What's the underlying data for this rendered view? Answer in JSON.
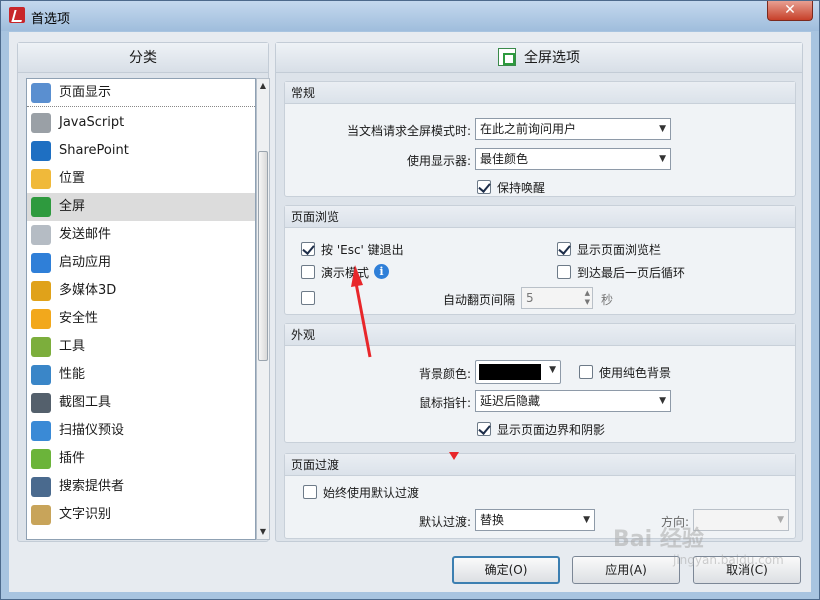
{
  "window": {
    "title": "首选项",
    "close_glyph": "✕"
  },
  "left": {
    "header": "分类",
    "items": [
      {
        "label": "页面显示",
        "icon": "page-display-icon",
        "color": "#5a8fd0"
      },
      {
        "label": "JavaScript",
        "icon": "javascript-icon",
        "color": "#9aa0a6"
      },
      {
        "label": "SharePoint",
        "icon": "sharepoint-icon",
        "color": "#1e6fc2"
      },
      {
        "label": "位置",
        "icon": "folder-icon",
        "color": "#f0b93a"
      },
      {
        "label": "全屏",
        "icon": "fullscreen-icon",
        "color": "#2e9a3e"
      },
      {
        "label": "发送邮件",
        "icon": "email-icon",
        "color": "#b5bcc4"
      },
      {
        "label": "启动应用",
        "icon": "launch-app-icon",
        "color": "#2f7fd8"
      },
      {
        "label": "多媒体3D",
        "icon": "multimedia-3d-icon",
        "color": "#e0a21a"
      },
      {
        "label": "安全性",
        "icon": "shield-icon",
        "color": "#f2a81c"
      },
      {
        "label": "工具",
        "icon": "tools-icon",
        "color": "#7cae3c"
      },
      {
        "label": "性能",
        "icon": "gauge-icon",
        "color": "#3a86c8"
      },
      {
        "label": "截图工具",
        "icon": "camera-icon",
        "color": "#54606c"
      },
      {
        "label": "扫描仪预设",
        "icon": "scanner-icon",
        "color": "#3a8ad6"
      },
      {
        "label": "插件",
        "icon": "puzzle-icon",
        "color": "#6bb43a"
      },
      {
        "label": "搜索提供者",
        "icon": "search-provider-icon",
        "color": "#4a6a8e"
      },
      {
        "label": "文字识别",
        "icon": "ocr-icon",
        "color": "#c8a45a"
      }
    ],
    "selected_index": 4
  },
  "right": {
    "header": "全屏选项",
    "general": {
      "title": "常规",
      "doc_request_label": "当文档请求全屏模式时:",
      "doc_request_value": "在此之前询问用户",
      "monitor_label": "使用显示器:",
      "monitor_value": "最佳颜色",
      "keep_awake_label": "保持唤醒",
      "keep_awake_checked": true
    },
    "browse": {
      "title": "页面浏览",
      "esc_label": "按 'Esc' 键退出",
      "esc_checked": true,
      "show_browser_label": "显示页面浏览栏",
      "show_browser_checked": true,
      "presentation_label": "演示模式",
      "presentation_checked": false,
      "loop_label": "到达最后一页后循环",
      "loop_checked": false,
      "auto_flip_checked": false,
      "auto_flip_label": "自动翻页间隔",
      "auto_flip_value": "5",
      "auto_flip_unit": "秒"
    },
    "appearance": {
      "title": "外观",
      "bg_color_label": "背景颜色:",
      "bg_color": "#000000",
      "solid_bg_label": "使用纯色背景",
      "solid_bg_checked": false,
      "cursor_label": "鼠标指针:",
      "cursor_value": "延迟后隐藏",
      "show_border_label": "显示页面边界和阴影",
      "show_border_checked": true
    },
    "transition": {
      "title": "页面过渡",
      "always_default_label": "始终使用默认过渡",
      "always_default_checked": false,
      "default_label": "默认过渡:",
      "default_value": "替换",
      "direction_label": "方向:",
      "direction_value": ""
    }
  },
  "buttons": {
    "ok": "确定(O)",
    "apply": "应用(A)",
    "cancel": "取消(C)"
  },
  "watermark": {
    "main": "Bai 经验",
    "sub": "jingyan.baidu.com"
  },
  "annotation_color": "#e8262a"
}
